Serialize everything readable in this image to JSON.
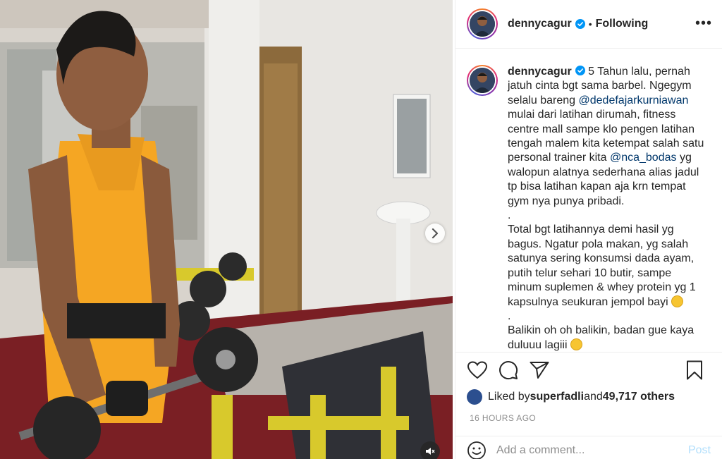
{
  "post": {
    "username": "dennycagur",
    "dot": "•",
    "following_label": "Following",
    "more_label": "•••",
    "caption": {
      "username": "dennycagur",
      "part1": " 5 Tahun lalu, pernah jatuh cinta bgt sama barbel. Ngegym selalu bareng ",
      "mention1": "@dedefajarkurniawan",
      "part2": " mulai dari latihan dirumah, fitness centre mall sampe klo pengen latihan tengah malem kita ketempat salah satu personal trainer kita ",
      "mention2": "@nca_bodas",
      "part3": " yg walopun alatnya sederhana alias jadul tp bisa latihan kapan aja krn tempat gym nya punya pribadi.",
      "sep1": ".",
      "para2": "Total bgt latihannya demi hasil yg bagus. Ngatur pola makan, yg salah satunya sering konsumsi dada ayam, putih telur sehari 10 butir, sampe minum suplemen & whey protein yg 1 kapsulnya seukuran jempol bayi",
      "sep2": ".",
      "para3": "Balikin oh oh balikin, badan gue kaya duluuu lagiii"
    },
    "likes": {
      "prefix": "Liked by ",
      "liker": "superfadli",
      "middle": " and ",
      "count": "49,717 others"
    },
    "timestamp": "16 HOURS AGO",
    "comment": {
      "placeholder": "Add a comment...",
      "post_label": "Post"
    }
  },
  "icons": {
    "verified": "verified-badge-icon",
    "like": "heart-icon",
    "comment": "comment-icon",
    "share": "paper-plane-icon",
    "save": "bookmark-icon",
    "next": "chevron-right-icon",
    "mute": "speaker-muted-icon",
    "emoji": "smiley-icon"
  },
  "colors": {
    "verified": "#0095f6",
    "mention": "#00376b",
    "post_disabled": "#b2dffc",
    "muted_text": "#8e8e8e"
  }
}
